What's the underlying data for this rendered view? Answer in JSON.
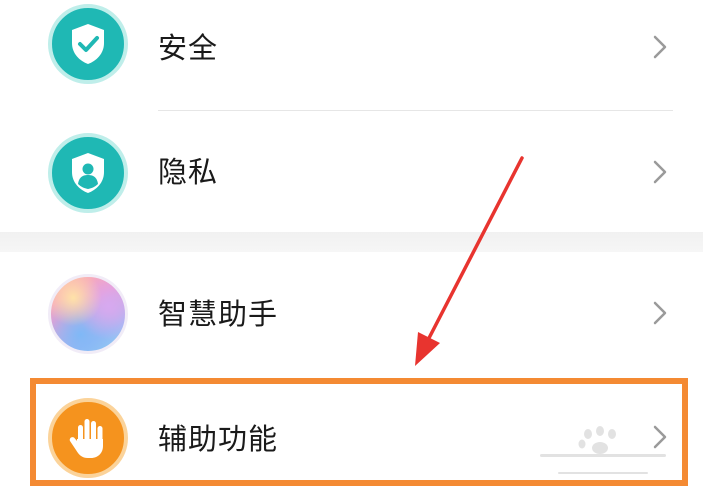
{
  "settings": {
    "items": [
      {
        "label": "安全",
        "icon": "shield-check-icon",
        "color": "#1fb8b4"
      },
      {
        "label": "隐私",
        "icon": "privacy-person-icon",
        "color": "#1fb8b4"
      },
      {
        "label": "智慧助手",
        "icon": "smart-assistant-icon",
        "color": "#ee9ed2"
      },
      {
        "label": "辅助功能",
        "icon": "hand-icon",
        "color": "#f5931e"
      }
    ]
  },
  "annotation": {
    "highlight_color": "#f48a33",
    "arrow_color": "#e8342f"
  }
}
